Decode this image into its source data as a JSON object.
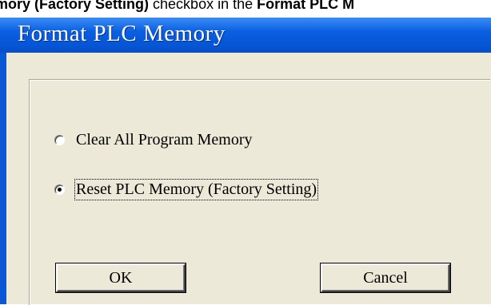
{
  "caption": {
    "before": "mory (Factory Setting)",
    "middle": " checkbox in the ",
    "after": "Format PLC M"
  },
  "dialog": {
    "title": "Format PLC Memory",
    "options": [
      {
        "label": "Clear All Program Memory",
        "selected": false
      },
      {
        "label": "Reset PLC Memory (Factory Setting)",
        "selected": true
      }
    ],
    "buttons": {
      "ok": "OK",
      "cancel": "Cancel"
    }
  },
  "colors": {
    "titlebar": "#0554d4",
    "client": "#ece9d8"
  }
}
